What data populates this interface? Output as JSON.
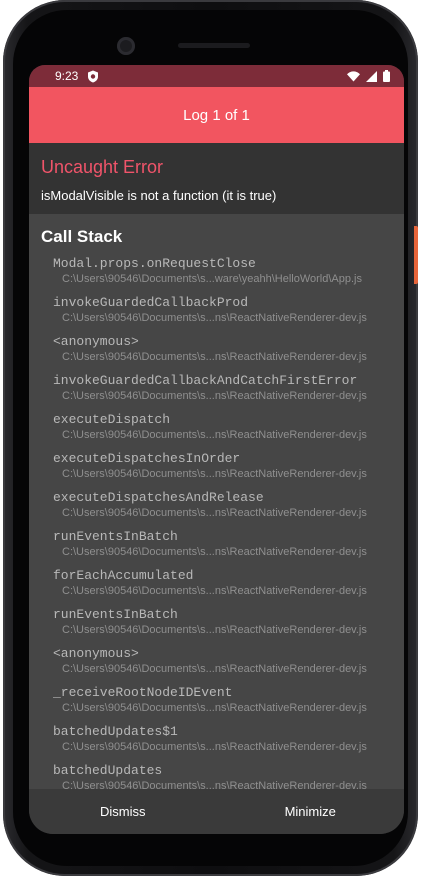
{
  "status_bar": {
    "time": "9:23",
    "icons": [
      "shield-icon",
      "wifi-icon",
      "signal-icon",
      "battery-icon"
    ]
  },
  "header": {
    "title": "Log 1 of 1"
  },
  "error": {
    "title": "Uncaught Error",
    "message": "isModalVisible is not a function (it is true)"
  },
  "call_stack": {
    "title": "Call Stack",
    "frames": [
      {
        "name": "Modal.props.onRequestClose",
        "path": "C:\\Users\\90546\\Documents\\s...ware\\yeahh\\HelloWorld\\App.js"
      },
      {
        "name": "invokeGuardedCallbackProd",
        "path": "C:\\Users\\90546\\Documents\\s...ns\\ReactNativeRenderer-dev.js"
      },
      {
        "name": "<anonymous>",
        "path": "C:\\Users\\90546\\Documents\\s...ns\\ReactNativeRenderer-dev.js"
      },
      {
        "name": "invokeGuardedCallbackAndCatchFirstError",
        "path": "C:\\Users\\90546\\Documents\\s...ns\\ReactNativeRenderer-dev.js"
      },
      {
        "name": "executeDispatch",
        "path": "C:\\Users\\90546\\Documents\\s...ns\\ReactNativeRenderer-dev.js"
      },
      {
        "name": "executeDispatchesInOrder",
        "path": "C:\\Users\\90546\\Documents\\s...ns\\ReactNativeRenderer-dev.js"
      },
      {
        "name": "executeDispatchesAndRelease",
        "path": "C:\\Users\\90546\\Documents\\s...ns\\ReactNativeRenderer-dev.js"
      },
      {
        "name": "runEventsInBatch",
        "path": "C:\\Users\\90546\\Documents\\s...ns\\ReactNativeRenderer-dev.js"
      },
      {
        "name": "forEachAccumulated",
        "path": "C:\\Users\\90546\\Documents\\s...ns\\ReactNativeRenderer-dev.js"
      },
      {
        "name": "runEventsInBatch",
        "path": "C:\\Users\\90546\\Documents\\s...ns\\ReactNativeRenderer-dev.js"
      },
      {
        "name": "<anonymous>",
        "path": "C:\\Users\\90546\\Documents\\s...ns\\ReactNativeRenderer-dev.js"
      },
      {
        "name": "_receiveRootNodeIDEvent",
        "path": "C:\\Users\\90546\\Documents\\s...ns\\ReactNativeRenderer-dev.js"
      },
      {
        "name": "batchedUpdates$1",
        "path": "C:\\Users\\90546\\Documents\\s...ns\\ReactNativeRenderer-dev.js"
      },
      {
        "name": "batchedUpdates",
        "path": "C:\\Users\\90546\\Documents\\s...ns\\ReactNativeRenderer-dev.js"
      }
    ]
  },
  "footer": {
    "dismiss_label": "Dismiss",
    "minimize_label": "Minimize"
  },
  "colors": {
    "header": "#f25560",
    "status_bar": "#7d2c39",
    "error_title": "#f0546a",
    "stack_background": "#464646",
    "footer": "#3a3a3a"
  }
}
